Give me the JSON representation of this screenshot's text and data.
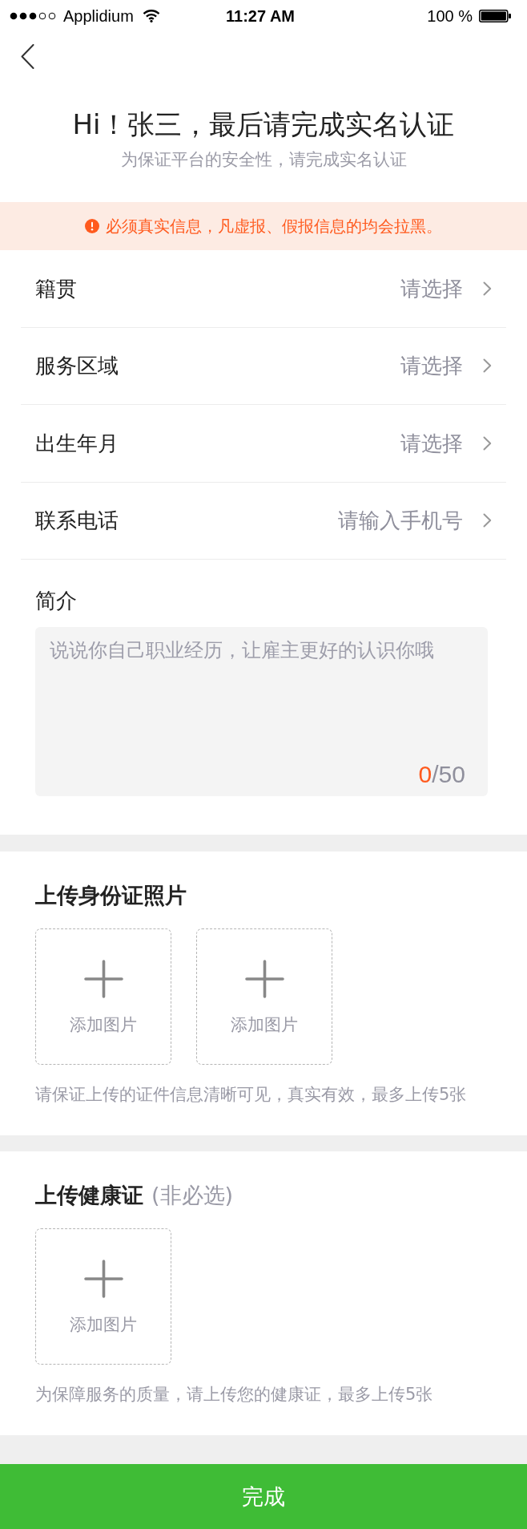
{
  "status_bar": {
    "carrier": "Applidium",
    "time": "11:27 AM",
    "battery": "100 %"
  },
  "header": {
    "title": "Hi！张三，最后请完成实名认证",
    "subtitle": "为保证平台的安全性，请完成实名认证"
  },
  "notice": {
    "text": "必须真实信息，凡虚报、假报信息的均会拉黑。"
  },
  "form": {
    "rows": [
      {
        "label": "籍贯",
        "placeholder": "请选择"
      },
      {
        "label": "服务区域",
        "placeholder": "请选择"
      },
      {
        "label": "出生年月",
        "placeholder": "请选择"
      },
      {
        "label": "联系电话",
        "placeholder": "请输入手机号"
      }
    ]
  },
  "bio": {
    "label": "简介",
    "placeholder": "说说你自己职业经历，让雇主更好的认识你哦",
    "count": "0",
    "limit": "/50"
  },
  "uploads": [
    {
      "title": "上传身份证照片",
      "slots": [
        {
          "label": "添加图片"
        },
        {
          "label": "添加图片"
        }
      ],
      "hint": "请保证上传的证件信息清晰可见，真实有效，最多上传5张"
    },
    {
      "title": "上传健康证",
      "note": "(非必选)",
      "slots": [
        {
          "label": "添加图片"
        }
      ],
      "hint": "为保障服务的质量，请上传您的健康证，最多上传5张"
    }
  ],
  "submit_button": {
    "label": "完成"
  }
}
